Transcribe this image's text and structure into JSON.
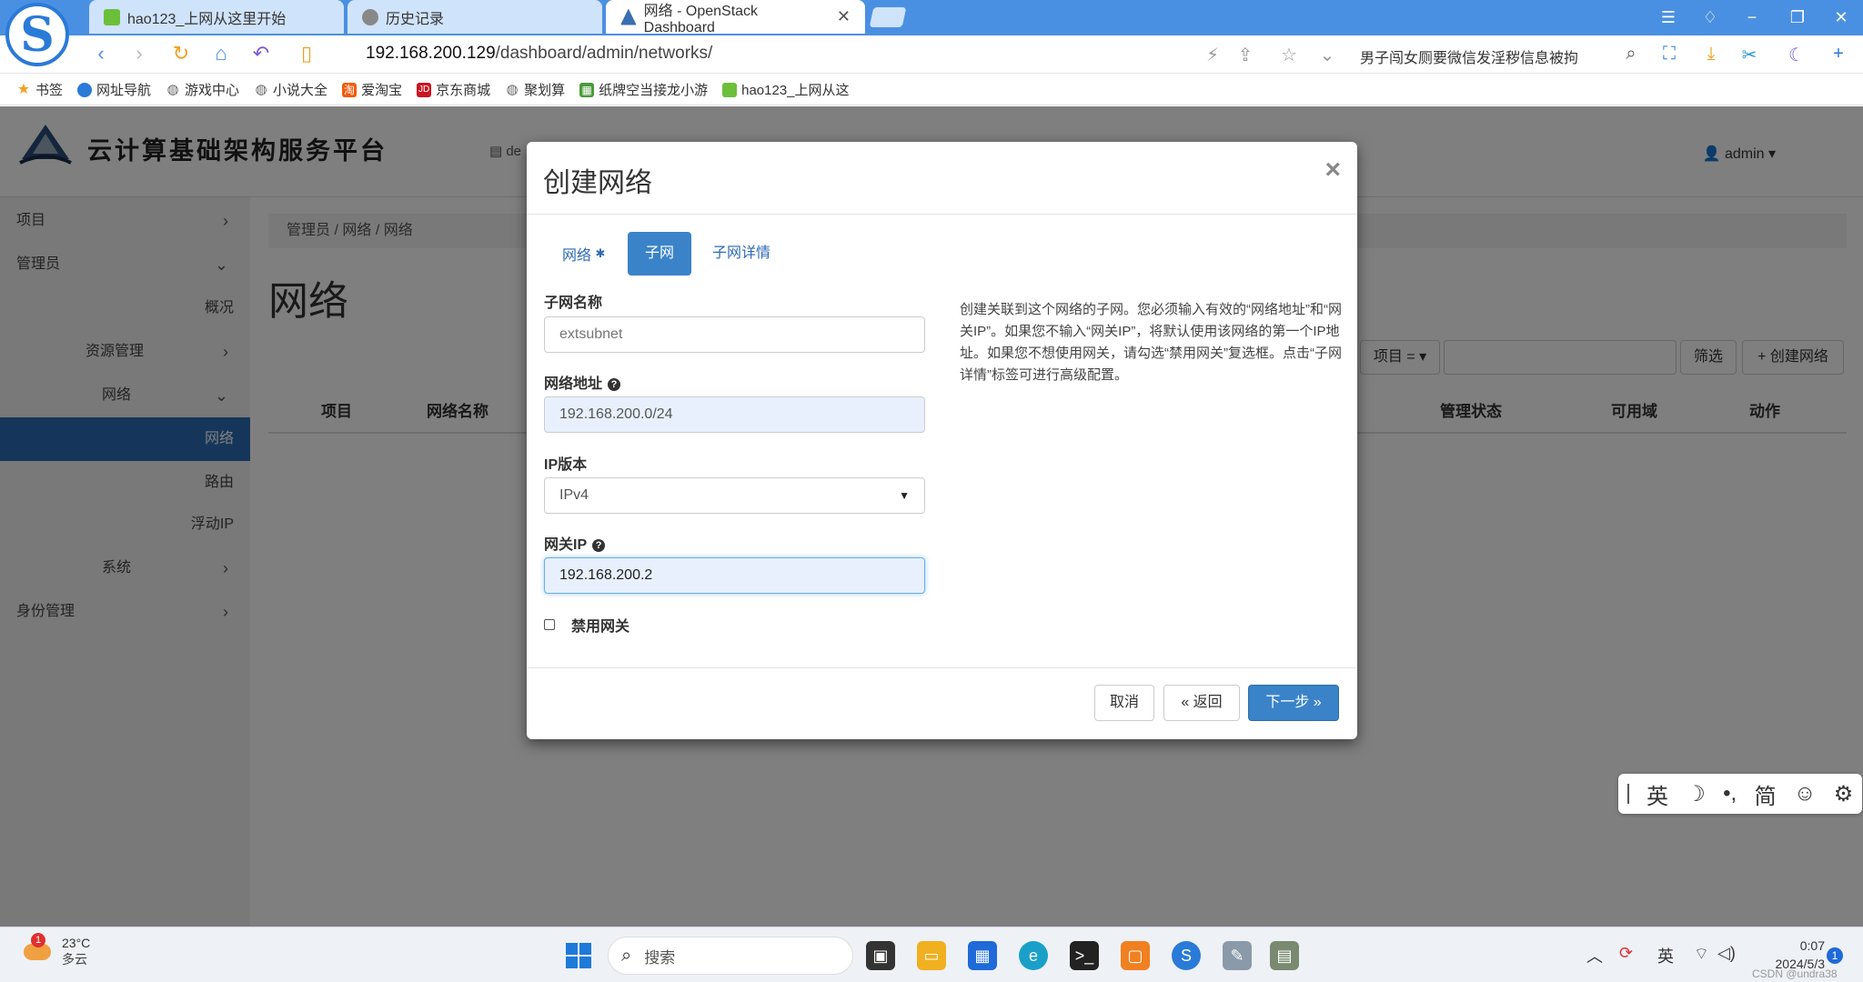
{
  "browser": {
    "tabs": [
      {
        "label": "hao123_上网从这里开始"
      },
      {
        "label": "历史记录"
      },
      {
        "label": "网络 - OpenStack Dashboard"
      }
    ],
    "url_host": "192.168.200.129",
    "url_path": "/dashboard/admin/networks/",
    "news_ticker": "男子闯女厕要微信发淫秽信息被拘",
    "bookmarks": [
      {
        "label": "书签",
        "icon": "star-icon"
      },
      {
        "label": "网址导航",
        "icon": "nav-icon"
      },
      {
        "label": "游戏中心",
        "icon": "globe-icon"
      },
      {
        "label": "小说大全",
        "icon": "globe-icon"
      },
      {
        "label": "爱淘宝",
        "icon": "taobao-icon"
      },
      {
        "label": "京东商城",
        "icon": "jd-icon"
      },
      {
        "label": "聚划算",
        "icon": "globe-icon"
      },
      {
        "label": "纸牌空当接龙小游",
        "icon": "game-icon"
      },
      {
        "label": "hao123_上网从这",
        "icon": "hao123-icon"
      }
    ]
  },
  "header": {
    "brand_text": "云计算基础架构服务平台",
    "project_selector": "de",
    "user": "admin"
  },
  "sidebar": {
    "items": [
      {
        "label": "项目",
        "chev": "›"
      },
      {
        "label": "管理员",
        "chev": "⌄"
      },
      {
        "label": "概况"
      },
      {
        "label": "资源管理",
        "chev": "›"
      },
      {
        "label": "网络",
        "chev": "⌄"
      },
      {
        "label": "网络"
      },
      {
        "label": "路由"
      },
      {
        "label": "浮动IP"
      },
      {
        "label": "系统",
        "chev": "›"
      },
      {
        "label": "身份管理",
        "chev": "›"
      }
    ]
  },
  "content": {
    "breadcrumb": [
      "管理员",
      "网络",
      "网络"
    ],
    "title": "网络",
    "filter": {
      "field": "项目 =",
      "filter_btn": "筛选",
      "create_btn": "创建网络"
    },
    "table_headers": [
      "项目",
      "网络名称",
      "管理状态",
      "可用域",
      "动作"
    ]
  },
  "modal": {
    "title": "创建网络",
    "close": "×",
    "tabs": [
      {
        "label": "网络",
        "required": "✱"
      },
      {
        "label": "子网"
      },
      {
        "label": "子网详情"
      }
    ],
    "fields": {
      "subnet_name": {
        "label": "子网名称",
        "placeholder": "extsubnet"
      },
      "network_address": {
        "label": "网络地址",
        "value": "192.168.200.0/24"
      },
      "ip_version": {
        "label": "IP版本",
        "value": "IPv4"
      },
      "gateway_ip": {
        "label": "网关IP",
        "value": "192.168.200.2"
      },
      "disable_gateway": {
        "label": "禁用网关",
        "checked": false
      }
    },
    "help_text": "创建关联到这个网络的子网。您必须输入有效的“网络地址”和“网关IP”。如果您不输入“网关IP”，将默认使用该网络的第一个IP地址。如果您不想使用网关，请勾选“禁用网关”复选框。点击“子网详情”标签可进行高级配置。",
    "buttons": {
      "cancel": "取消",
      "back": "« 返回",
      "next": "下一步 »"
    }
  },
  "ime": {
    "items": [
      "英",
      "☽",
      "•,",
      "简",
      "☺",
      "⚙"
    ]
  },
  "taskbar": {
    "weather_temp": "23°C",
    "weather_desc": "多云",
    "weather_badge": "1",
    "search_placeholder": "搜索",
    "ime_lang": "英",
    "time": "0:07",
    "date": "2024/5/3",
    "notif_count": "1",
    "watermark": "CSDN @undra38"
  },
  "colors": {
    "accent": "#3a83c9",
    "sidebar_active": "#2b6cb5",
    "browser_tabbar": "#4a90e2"
  }
}
